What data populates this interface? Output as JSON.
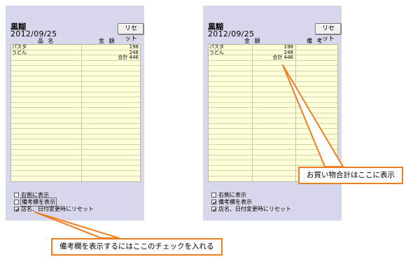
{
  "panels": [
    {
      "store": "黒糊",
      "date": "2012/09/25",
      "reset_label": "リセット",
      "col_name": "品 名",
      "col_amount": "金 額",
      "col_note": "",
      "items": [
        {
          "name": "パスタ",
          "amount": "198"
        },
        {
          "name": "うどん",
          "amount": "248"
        }
      ],
      "total": "合計 446",
      "checkboxes": [
        {
          "label": "右側に表示",
          "checked": false
        },
        {
          "label": "備考欄を表示",
          "checked": false
        },
        {
          "label": "店名、日付変更時にリセット",
          "checked": true
        }
      ]
    },
    {
      "store": "黒糊",
      "date": "2012/09/25",
      "reset_label": "リセット",
      "col_name": "金 額",
      "col_amount": "",
      "col_note": "備 考",
      "items": [
        {
          "name": "パスタ",
          "amount": "198"
        },
        {
          "name": "うどん",
          "amount": "248"
        }
      ],
      "total": "合計 446",
      "checkboxes": [
        {
          "label": "右側に表示",
          "checked": false
        },
        {
          "label": "備考欄を表示",
          "checked": true
        },
        {
          "label": "店名、日付変更時にリセット",
          "checked": true
        }
      ]
    }
  ],
  "callouts": {
    "total": "お買い物合計はここに表示",
    "note_check": "備考欄を表示するにはここのチェックを入れる"
  },
  "accent_color": "#ef7d22"
}
